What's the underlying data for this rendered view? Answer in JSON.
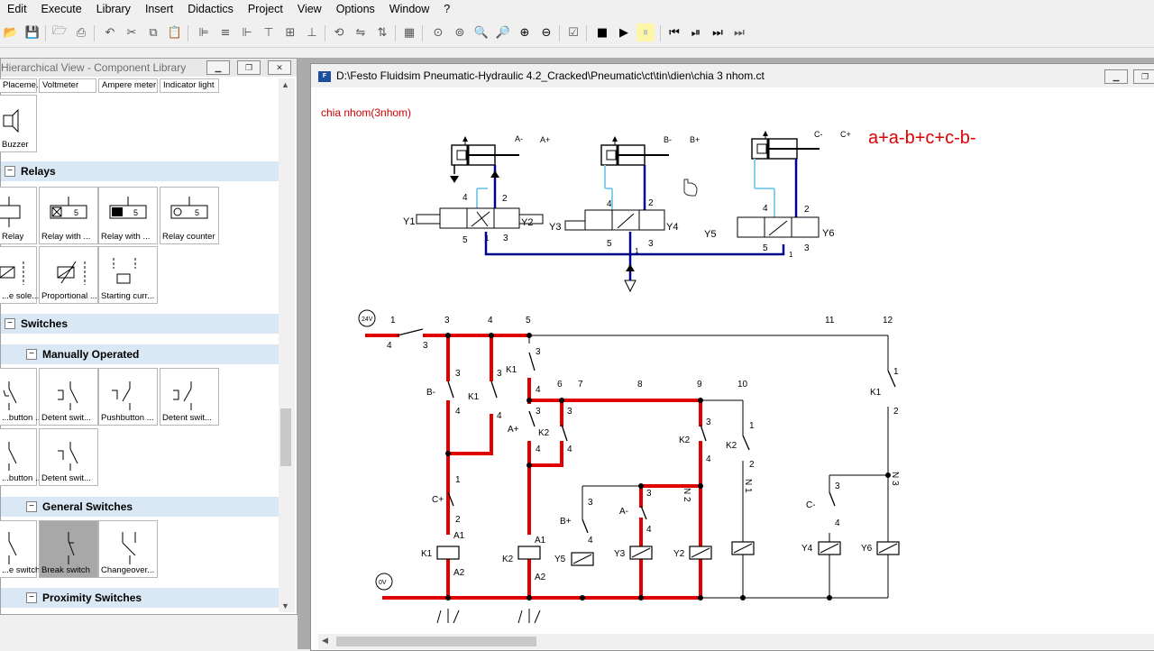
{
  "menu": [
    "Edit",
    "Execute",
    "Library",
    "Insert",
    "Didactics",
    "Project",
    "View",
    "Options",
    "Window",
    "?"
  ],
  "library": {
    "title": "Hierarchical View - Component Library",
    "top_items": [
      "Placeme...",
      "Voltmeter",
      "Ampere meter",
      "Indicator light"
    ],
    "buzzer": "Buzzer",
    "sections": {
      "relays": "Relays",
      "switches": "Switches",
      "manual": "Manually Operated",
      "general": "General Switches",
      "proximity": "Proximity Switches"
    },
    "relay_items": [
      "Relay",
      "Relay with ...",
      "Relay with ...",
      "Relay counter",
      "...e sole...",
      "Proportional ...",
      "Starting curr..."
    ],
    "manual_items": [
      "...button ...",
      "Detent swit...",
      "Pushbutton ...",
      "Detent swit...",
      "...button ...",
      "Detent swit..."
    ],
    "general_items": [
      "...e switch",
      "Break switch",
      "Changeover..."
    ]
  },
  "document": {
    "title": "D:\\Festo Fluidsim Pneumatic-Hydraulic 4.2_Cracked\\Pneumatic\\ct\\tin\\dien\\chia 3 nhom.ct",
    "caption": "chia  nhom(3nhom)",
    "sequence": "a+a-b+c+c-b-"
  },
  "colors": {
    "active": "#e00000",
    "pneumatic": "#00008b",
    "signal": "#87ceeb"
  }
}
